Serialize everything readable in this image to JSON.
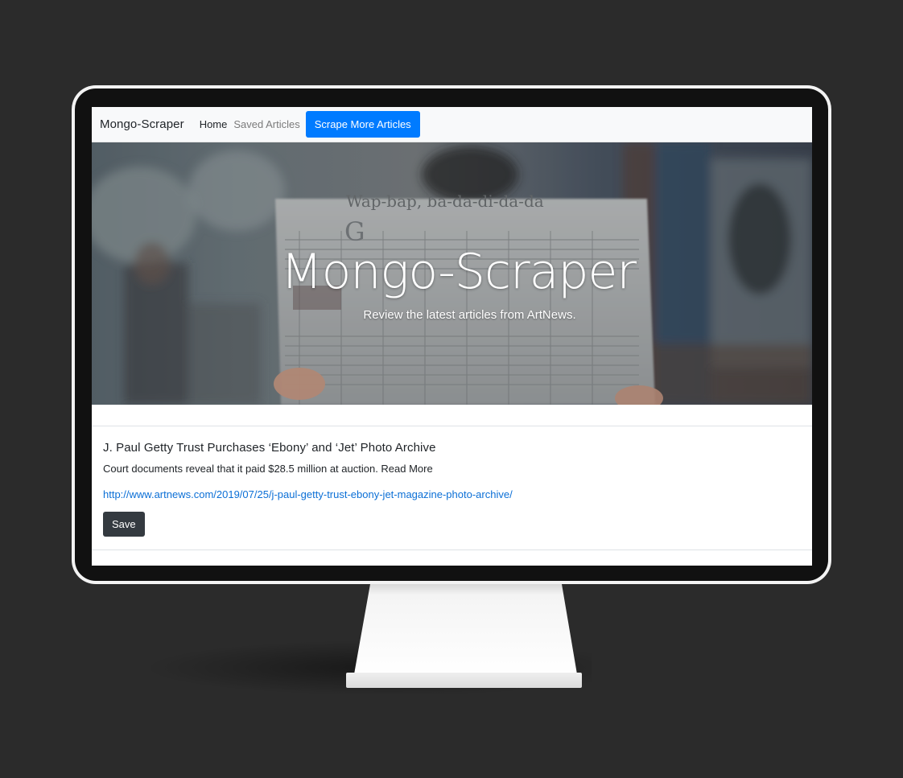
{
  "navbar": {
    "brand": "Mongo-Scraper",
    "links": [
      {
        "label": "Home"
      },
      {
        "label": "Saved Articles"
      }
    ],
    "scrape_button": "Scrape More Articles"
  },
  "hero": {
    "title": "Mongo-Scraper",
    "subtitle": "Review the latest articles from ArtNews.",
    "newspaper_headline": "Wap-bap, ba-da-di-da-da"
  },
  "articles": [
    {
      "title": "J. Paul Getty Trust Purchases ‘Ebony’ and ‘Jet’ Photo Archive",
      "summary": "Court documents reveal that it paid $28.5 million at auction. Read More",
      "link": "http://www.artnews.com/2019/07/25/j-paul-getty-trust-ebony-jet-magazine-photo-archive/",
      "save_label": "Save"
    }
  ],
  "colors": {
    "background": "#2b2b2b",
    "primary": "#007bff",
    "dark_button": "#343a40",
    "link": "#0b6fd6"
  }
}
